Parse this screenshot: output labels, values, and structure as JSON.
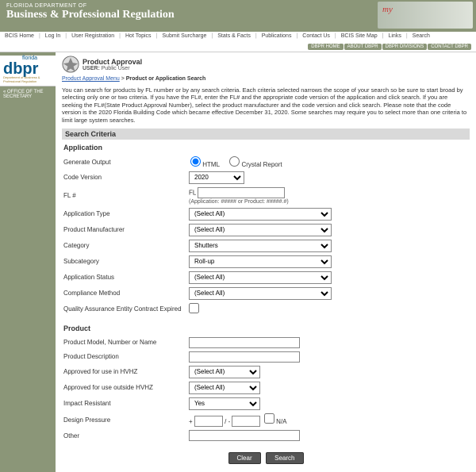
{
  "banner": {
    "dept": "FLORIDA DEPARTMENT OF",
    "title": "Business & Professional Regulation"
  },
  "topnav": {
    "items": [
      "BCIS Home",
      "Log In",
      "User Registration",
      "Hot Topics",
      "Submit Surcharge",
      "Stats & Facts",
      "Publications",
      "Contact Us",
      "BCIS Site Map",
      "Links",
      "Search"
    ],
    "tabs": [
      "DBPR HOME",
      "ABOUT DBPR",
      "DBPR DIVISIONS",
      "CONTACT DBPR"
    ]
  },
  "logo": {
    "florida": "florida",
    "main": "dbpr",
    "sub": "Department of Business & Professional Regulation"
  },
  "sidebar": {
    "office": "« OFFICE OF THE SECRETARY"
  },
  "page": {
    "title": "Product Approval",
    "user_label": "USER:",
    "user_value": "Public User",
    "breadcrumb_link": "Product Approval Menu",
    "breadcrumb_sep": ">",
    "breadcrumb_current": "Product or Application Search",
    "intro": "You can search for products by FL number or by any search criteria. Each criteria selected narrows the scope of your search so be sure to start broad by selecting only one or two criteria. If you have the FL#, enter the FL# and the appropriate code version of the application and click search. If you are seeking the FL#(State Product Approval Number), select the product manufacturer and the code version and click search.\nPlease note that the code version is the 2020 Florida Building Code which became effective December 31, 2020. Some searches may require you to select more than one criteria to limit large system searches."
  },
  "form": {
    "section": "Search Criteria",
    "app_head": "Application",
    "labels": {
      "generate": "Generate Output",
      "html": "HTML",
      "crystal": "Crystal Report",
      "code_version": "Code Version",
      "fl": "FL #",
      "fl_prefix": "FL",
      "fl_hint": "(Application: #####  or Product: #####.#)",
      "app_type": "Application Type",
      "manufacturer": "Product Manufacturer",
      "category": "Category",
      "subcategory": "Subcategory",
      "app_status": "Application Status",
      "compliance": "Compliance Method",
      "qa_expired": "Quality Assurance Entity Contract Expired",
      "prod_head": "Product",
      "model": "Product Model, Number or Name",
      "description": "Product Description",
      "in_hvhz": "Approved for use in HVHZ",
      "out_hvhz": "Approved for use outside HVHZ",
      "impact": "Impact Resistant",
      "design": "Design Pressure",
      "na": "N/A",
      "other": "Other"
    },
    "values": {
      "code_version": "2020",
      "app_type": "(Select All)",
      "manufacturer": "(Select All)",
      "category": "Shutters",
      "subcategory": "Roll-up",
      "app_status": "(Select All)",
      "compliance": "(Select All)",
      "in_hvhz": "(Select All)",
      "out_hvhz": "(Select All)",
      "impact": "Yes",
      "dp_sign": "+",
      "dp_sep": " / - "
    },
    "buttons": {
      "clear": "Clear",
      "search": "Search"
    }
  }
}
